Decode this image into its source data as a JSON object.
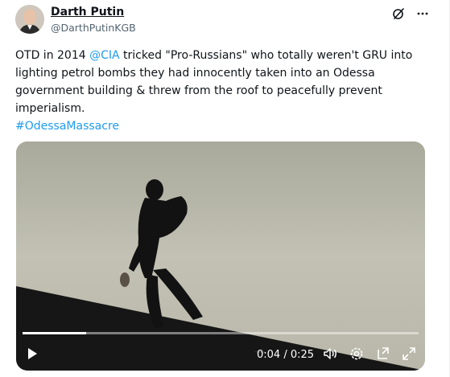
{
  "author": {
    "name": "Darth Putin",
    "handle": "@DarthPutinKGB"
  },
  "tweet": {
    "part1": "OTD in 2014 ",
    "mention": "@CIA",
    "part2": " tricked \"Pro-Russians\" who totally weren't GRU into lighting petrol bombs they had innocently taken into an Odessa government building & threw from the roof to peacefully prevent imperialism.",
    "hashtag": "#OdessaMassacre"
  },
  "video": {
    "current_time": "0:04",
    "separator": " / ",
    "duration": "0:25",
    "progress_fraction": 0.16
  },
  "icons": {
    "top": [
      "grok-icon",
      "more-icon"
    ],
    "controls": [
      "play-icon",
      "volume-icon",
      "settings-icon",
      "popout-icon",
      "fullscreen-icon"
    ]
  },
  "colors": {
    "link": "#1d9bf0",
    "handle": "#536471",
    "video_background": "#bdbcae"
  }
}
